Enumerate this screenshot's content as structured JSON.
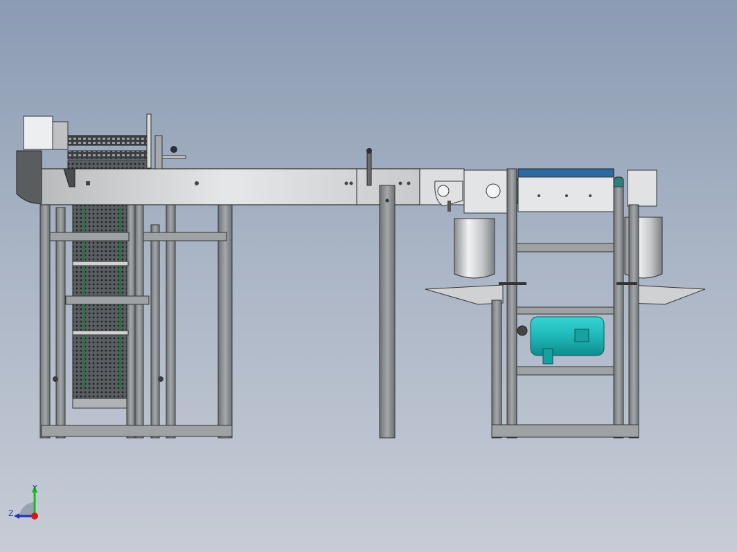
{
  "viewport": {
    "background_top": "#8b9bb3",
    "background_bottom": "#c7ccd6"
  },
  "colors": {
    "frame": "#8e9294",
    "frame_dark": "#4a4d50",
    "beam": "#d4d6d8",
    "mesh": "#3a3d40",
    "motor_green": "#1fb8b8",
    "steel_light": "#e4e6e8",
    "axis_x": "#d01818",
    "axis_y": "#18b818",
    "axis_z": "#2030c0"
  },
  "triad": {
    "y_label": "Y",
    "z_label": "Z",
    "icons": [
      "x-axis-arrow-icon",
      "y-axis-arrow-icon",
      "z-axis-arrow-icon"
    ]
  }
}
